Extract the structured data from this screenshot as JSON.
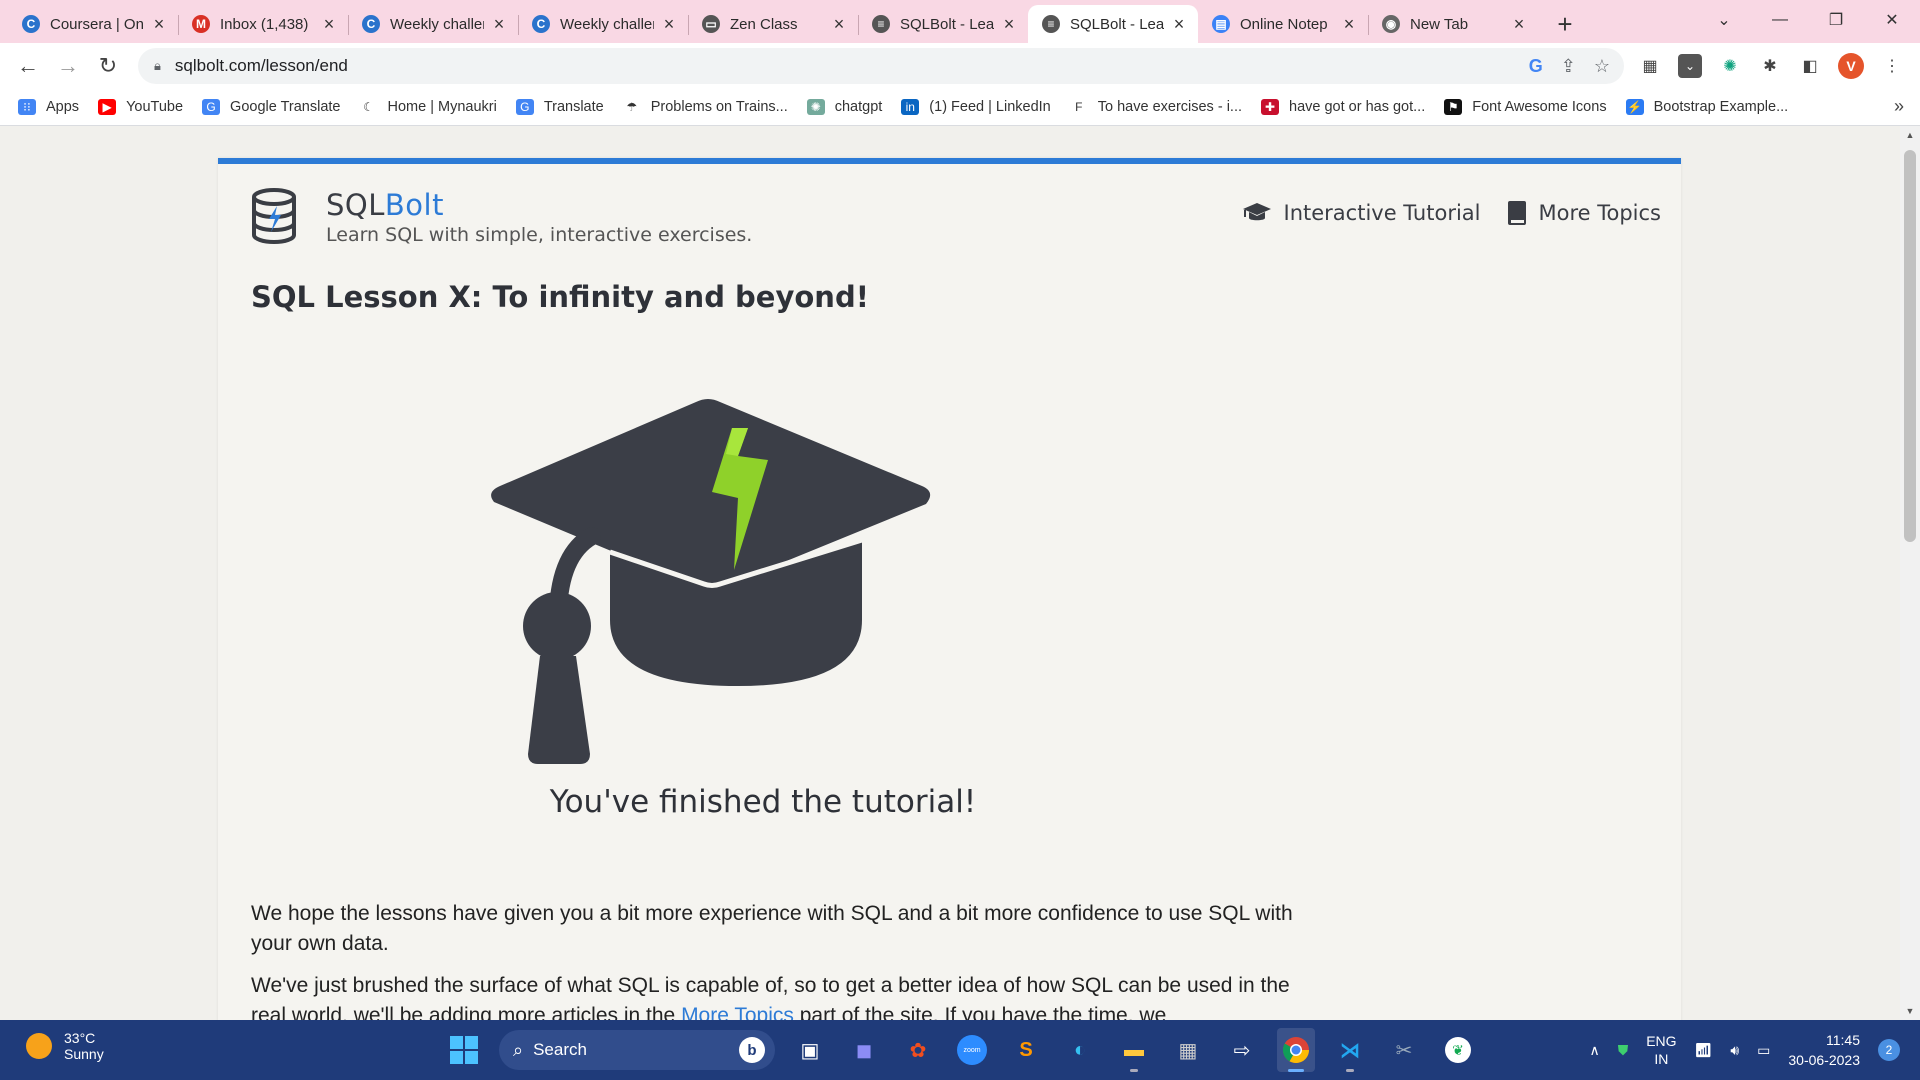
{
  "browser": {
    "tabs": [
      {
        "title": "Coursera | Onl",
        "icon": "coursera-icon",
        "color": "#2a73cc",
        "glyph": "C"
      },
      {
        "title": "Inbox (1,438)",
        "icon": "gmail-icon",
        "color": "#d93025",
        "glyph": "M"
      },
      {
        "title": "Weekly challer",
        "icon": "coursera-icon",
        "color": "#2a73cc",
        "glyph": "C"
      },
      {
        "title": "Weekly challer",
        "icon": "coursera-icon",
        "color": "#2a73cc",
        "glyph": "C"
      },
      {
        "title": "Zen Class",
        "icon": "page-icon",
        "color": "#555555",
        "glyph": "▭"
      },
      {
        "title": "SQLBolt - Lear",
        "icon": "database-icon",
        "color": "#555555",
        "glyph": "≡"
      },
      {
        "title": "SQLBolt - Lear",
        "icon": "database-icon",
        "color": "#555555",
        "glyph": "≡",
        "active": true
      },
      {
        "title": "Online Notep",
        "icon": "doc-icon",
        "color": "#3b82f6",
        "glyph": "▤"
      },
      {
        "title": "New Tab",
        "icon": "chrome-icon",
        "color": "#666666",
        "glyph": "◉"
      }
    ],
    "url": "sqlbolt.com/lesson/end",
    "bookmarks": [
      {
        "label": "Apps",
        "icon": "apps-grid-icon",
        "color": "#4285f4",
        "glyph": "⁝⁝"
      },
      {
        "label": "YouTube",
        "icon": "youtube-icon",
        "color": "#ff0000",
        "glyph": "▶"
      },
      {
        "label": "Google Translate",
        "icon": "translate-icon",
        "color": "#4285f4",
        "glyph": "G"
      },
      {
        "label": "Home | Mynaukri",
        "icon": "mynaukri-icon",
        "color": "#ffffff",
        "glyph": "☾"
      },
      {
        "label": "Translate",
        "icon": "translate-icon",
        "color": "#4285f4",
        "glyph": "G"
      },
      {
        "label": "Problems on Trains...",
        "icon": "umbrella-icon",
        "color": "#ffffff",
        "glyph": "☂"
      },
      {
        "label": "chatgpt",
        "icon": "chatgpt-icon",
        "color": "#74aa9c",
        "glyph": "✺"
      },
      {
        "label": "(1) Feed | LinkedIn",
        "icon": "linkedin-icon",
        "color": "#0a66c2",
        "glyph": "in"
      },
      {
        "label": "To have exercises - i...",
        "icon": "exercise-icon",
        "color": "#ffffff",
        "glyph": "F"
      },
      {
        "label": "have got or has got...",
        "icon": "uk-flag-icon",
        "color": "#c8102e",
        "glyph": "✚"
      },
      {
        "label": "Font Awesome Icons",
        "icon": "flag-icon",
        "color": "#111111",
        "glyph": "⚑"
      },
      {
        "label": "Bootstrap Example...",
        "icon": "bolt-icon",
        "color": "#2b7bf3",
        "glyph": "⚡"
      }
    ],
    "profile_initial": "V"
  },
  "site": {
    "brand_prefix": "SQL",
    "brand_suffix": "Bolt",
    "tagline": "Learn SQL with simple, interactive exercises.",
    "nav": [
      {
        "label": "Interactive Tutorial",
        "icon": "graduation-cap-icon"
      },
      {
        "label": "More Topics",
        "icon": "book-icon"
      }
    ],
    "colors": {
      "accent": "#2d7bd6",
      "cap": "#3b3e47",
      "bolt": "#8fd12a"
    }
  },
  "lesson": {
    "title": "SQL Lesson X: To infinity and beyond!",
    "finished": "You've finished the tutorial!",
    "para1": "We hope the lessons have given you a bit more experience with SQL and a bit more confidence to use SQL with your own data.",
    "para2_before": "We've just brushed the surface of what SQL is capable of, so to get a better idea of how SQL can be used in the real world, we'll be adding more articles in the ",
    "para2_link": "More Topics",
    "para2_after": " part of the site. If you have the time, we"
  },
  "taskbar": {
    "temperature": "33°C",
    "weather": "Sunny",
    "search_placeholder": "Search",
    "lang_top": "ENG",
    "lang_bottom": "IN",
    "time": "11:45",
    "date": "30-06-2023",
    "notifications": "2"
  }
}
